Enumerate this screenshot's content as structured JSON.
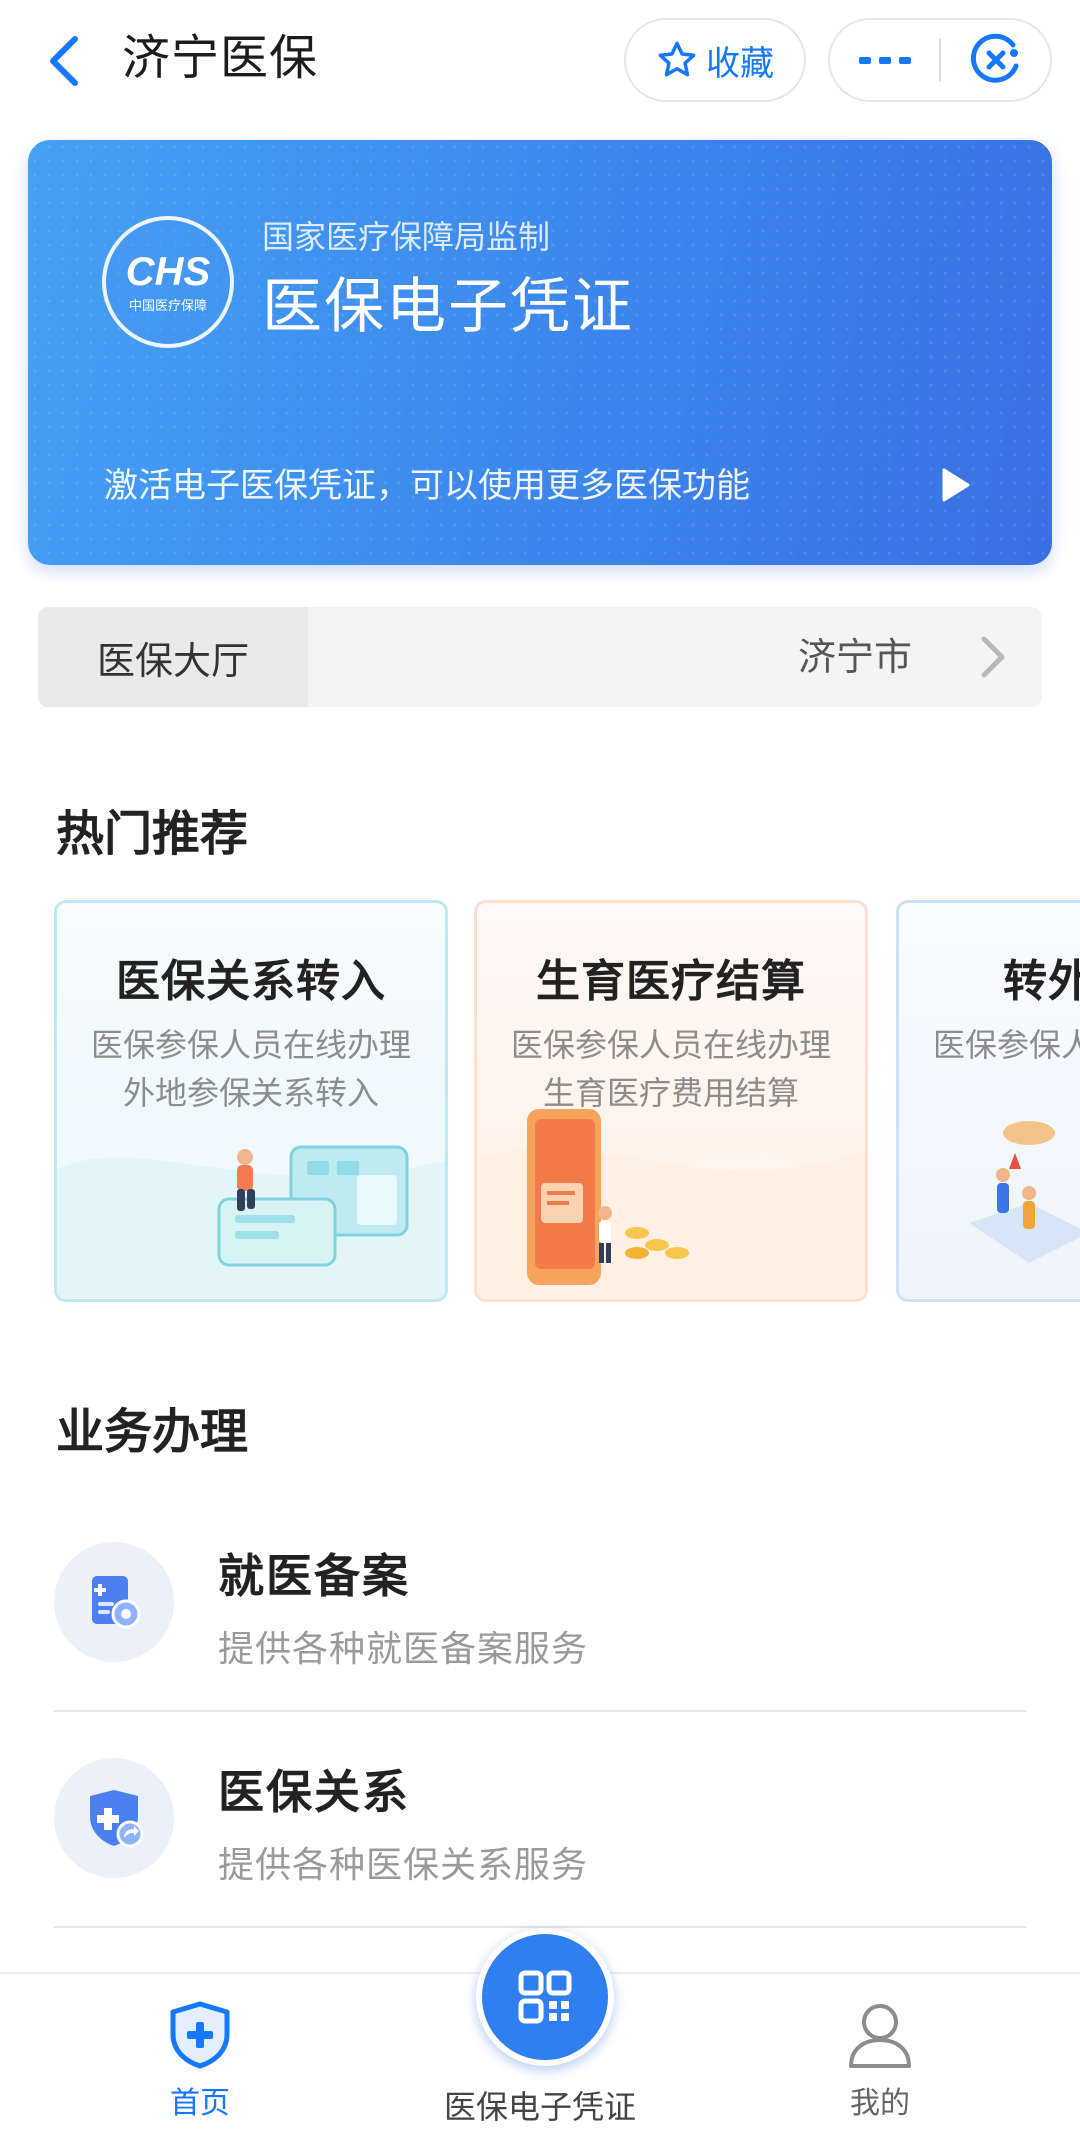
{
  "header": {
    "title": "济宁医保",
    "favorite_label": "收藏"
  },
  "banner": {
    "logo_text": "CHS",
    "logo_subtext": "中国医疗保障",
    "supervise": "国家医疗保障局监制",
    "title": "医保电子凭证",
    "activate_text": "激活电子医保凭证，可以使用更多医保功能"
  },
  "hall": {
    "tab_label": "医保大厅",
    "city": "济宁市"
  },
  "hot": {
    "section_title": "热门推荐",
    "cards": [
      {
        "title": "医保关系转入",
        "desc": "医保参保人员在线办理外地参保关系转入"
      },
      {
        "title": "生育医疗结算",
        "desc": "医保参保人员在线办理生育医疗费用结算"
      },
      {
        "title": "转外",
        "desc": "医保参保人疗"
      }
    ]
  },
  "business": {
    "section_title": "业务办理",
    "items": [
      {
        "name": "就医备案",
        "desc": "提供各种就医备案服务"
      },
      {
        "name": "医保关系",
        "desc": "提供各种医保关系服务"
      }
    ]
  },
  "tabbar": {
    "home": "首页",
    "center": "医保电子凭证",
    "mine": "我的"
  },
  "colors": {
    "accent": "#1677ff",
    "banner_start": "#45a0f4",
    "banner_end": "#3a6fe2"
  },
  "icons": {
    "back": "chevron-left-icon",
    "favorite": "star-icon",
    "more": "more-icon",
    "close": "close-circle-icon",
    "play": "play-icon",
    "home": "shield-plus-icon",
    "qr": "qr-code-icon",
    "mine": "user-icon"
  }
}
